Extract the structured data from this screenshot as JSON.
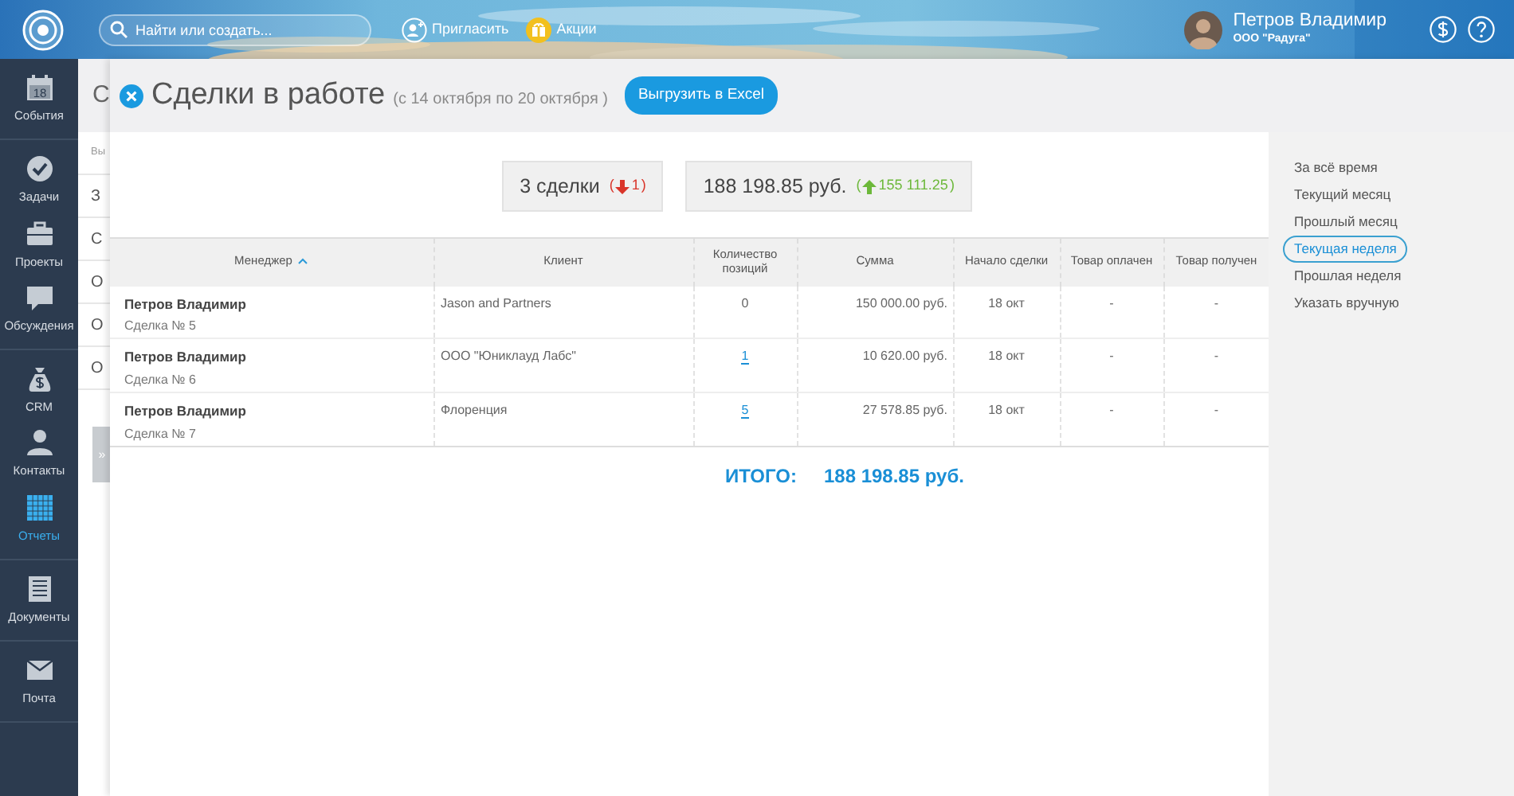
{
  "header": {
    "search": {
      "placeholder": "Найти или создать..."
    },
    "links": [
      {
        "label": "Пригласить",
        "kind": "invite"
      },
      {
        "label": "Акции",
        "kind": "promo"
      }
    ],
    "user": {
      "name": "Петров Владимир",
      "company": "ООО \"Радуга\""
    }
  },
  "sidebar": {
    "groups": [
      [
        {
          "label": "События",
          "kind": "calendar",
          "badge": "18",
          "selected": false
        }
      ],
      [
        {
          "label": "Задачи",
          "kind": "tasks",
          "selected": false
        },
        {
          "label": "Проекты",
          "kind": "projects",
          "selected": false
        },
        {
          "label": "Обсуждения",
          "kind": "chat",
          "selected": false
        }
      ],
      [
        {
          "label": "CRM",
          "kind": "crm",
          "selected": false
        },
        {
          "label": "Контакты",
          "kind": "contacts",
          "selected": false
        },
        {
          "label": "Отчеты",
          "kind": "reports",
          "selected": true
        }
      ],
      [
        {
          "label": "Документы",
          "kind": "documents",
          "selected": false
        }
      ],
      [
        {
          "label": "Почта",
          "kind": "mail",
          "selected": false
        }
      ]
    ]
  },
  "background_page": {
    "title": "С",
    "items": [
      "Вы",
      "З",
      "С",
      "О",
      "О",
      "О"
    ],
    "toggle": "»"
  },
  "panel": {
    "title": "Сделки в работе",
    "subtitle": "(с 14 октября по 20 октября )",
    "export_button": "Выгрузить в Excel",
    "stats": [
      {
        "value": "3 сделки",
        "decrease": true,
        "open": "(",
        "change": "1",
        "close": ")"
      },
      {
        "value": "188 198.85 руб.",
        "decrease": false,
        "open": "(",
        "change": "155 111.25",
        "close": ")"
      }
    ],
    "table": {
      "columns": [
        {
          "label": "Менеджер",
          "sorted": true
        },
        {
          "label": "Клиент",
          "sorted": false
        },
        {
          "label": "Количество позиций",
          "sorted": false
        },
        {
          "label": "Сумма",
          "sorted": false
        },
        {
          "label": "Начало сделки",
          "sorted": false
        },
        {
          "label": "Товар оплачен",
          "sorted": false
        },
        {
          "label": "Товар получен",
          "sorted": false
        }
      ],
      "rows": [
        {
          "manager": "Петров Владимир",
          "deal": "Сделка № 5",
          "client": "Jason and Partners",
          "positions": "0",
          "positions_link": false,
          "sum": "150 000.00 руб.",
          "start": "18 окт",
          "paid": "-",
          "received": "-"
        },
        {
          "manager": "Петров Владимир",
          "deal": "Сделка № 6",
          "client": "ООО \"Юниклауд Лабс\"",
          "positions": "1",
          "positions_link": true,
          "sum": "10 620.00 руб.",
          "start": "18 окт",
          "paid": "-",
          "received": "-"
        },
        {
          "manager": "Петров Владимир",
          "deal": "Сделка № 7",
          "client": "Флоренция",
          "positions": "5",
          "positions_link": true,
          "sum": "27 578.85 руб.",
          "start": "18 окт",
          "paid": "-",
          "received": "-"
        }
      ]
    },
    "total": {
      "label": "ИТОГО:",
      "value": "188 198.85 руб."
    }
  },
  "periods": [
    {
      "label": "За всё время",
      "selected": false
    },
    {
      "label": "Текущий месяц",
      "selected": false
    },
    {
      "label": "Прошлый месяц",
      "selected": false
    },
    {
      "label": "Текущая неделя",
      "selected": true
    },
    {
      "label": "Прошлая неделя",
      "selected": false
    },
    {
      "label": "Указать вручную",
      "selected": false
    }
  ]
}
